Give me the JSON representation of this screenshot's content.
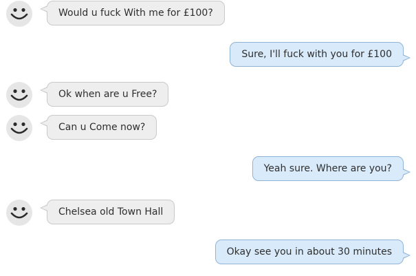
{
  "conversation": {
    "messages": [
      {
        "direction": "incoming",
        "avatar_icon": "smiley-face-icon",
        "text": "Would u fuck With me for £100?"
      },
      {
        "direction": "outgoing",
        "text": "Sure, I'll fuck with you for £100"
      },
      {
        "direction": "incoming",
        "avatar_icon": "smiley-face-icon",
        "text": "Ok when are u Free?"
      },
      {
        "direction": "incoming",
        "avatar_icon": "smiley-face-icon",
        "text": "Can u Come now?"
      },
      {
        "direction": "outgoing",
        "text": "Yeah sure. Where are you?"
      },
      {
        "direction": "incoming",
        "avatar_icon": "smiley-face-icon",
        "text": "Chelsea old Town Hall"
      },
      {
        "direction": "outgoing",
        "text": "Okay see you in about 30 minutes"
      }
    ]
  },
  "colors": {
    "incoming_bubble": "#eeeeee",
    "incoming_border": "#c9c9c9",
    "outgoing_bubble": "#d9ebfb",
    "outgoing_border": "#8fb3d6",
    "avatar_face": "#e6e6e6",
    "avatar_features": "#2b2b2b"
  }
}
